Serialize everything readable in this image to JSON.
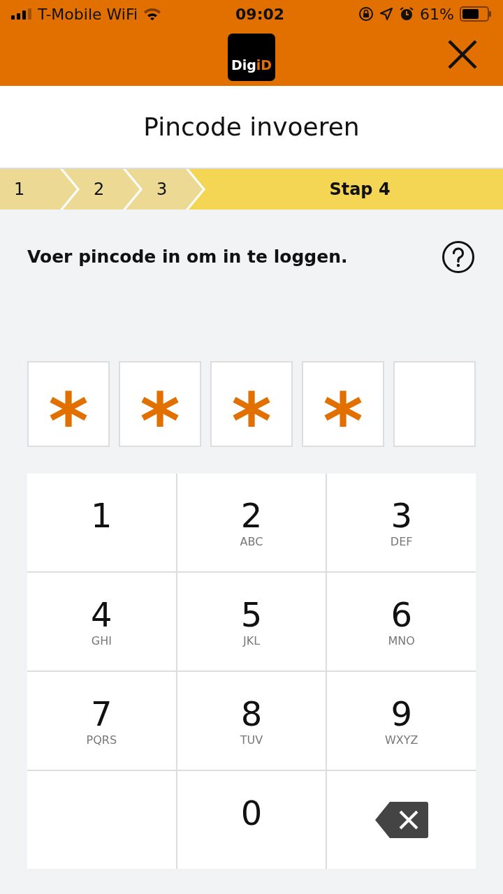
{
  "status_bar": {
    "carrier": "T-Mobile WiFi",
    "time": "09:02",
    "battery": "61%"
  },
  "header": {
    "logo_main": "Dig",
    "logo_accent": "iD"
  },
  "title": "Pincode invoeren",
  "steps": [
    {
      "label": "1",
      "selected": false
    },
    {
      "label": "2",
      "selected": false
    },
    {
      "label": "3",
      "selected": false
    },
    {
      "label": "Stap 4",
      "selected": true
    }
  ],
  "instruction": "Voer pincode in om in te loggen.",
  "pin_boxes": [
    {
      "kind": "filled",
      "symbol": "*"
    },
    {
      "kind": "filled",
      "symbol": "*"
    },
    {
      "kind": "filled",
      "symbol": "*"
    },
    {
      "kind": "filled",
      "symbol": "*"
    },
    {
      "kind": "empty"
    }
  ],
  "keypad": [
    {
      "kind": "digit",
      "digit": "1"
    },
    {
      "kind": "digit",
      "digit": "2",
      "letters": "ABC"
    },
    {
      "kind": "digit",
      "digit": "3",
      "letters": "DEF"
    },
    {
      "kind": "digit",
      "digit": "4",
      "letters": "GHI"
    },
    {
      "kind": "digit",
      "digit": "5",
      "letters": "JKL"
    },
    {
      "kind": "digit",
      "digit": "6",
      "letters": "MNO"
    },
    {
      "kind": "digit",
      "digit": "7",
      "letters": "PQRS"
    },
    {
      "kind": "digit",
      "digit": "8",
      "letters": "TUV"
    },
    {
      "kind": "digit",
      "digit": "9",
      "letters": "WXYZ"
    },
    {
      "kind": "blank"
    },
    {
      "kind": "digit",
      "digit": "0"
    },
    {
      "kind": "backspace"
    }
  ]
}
